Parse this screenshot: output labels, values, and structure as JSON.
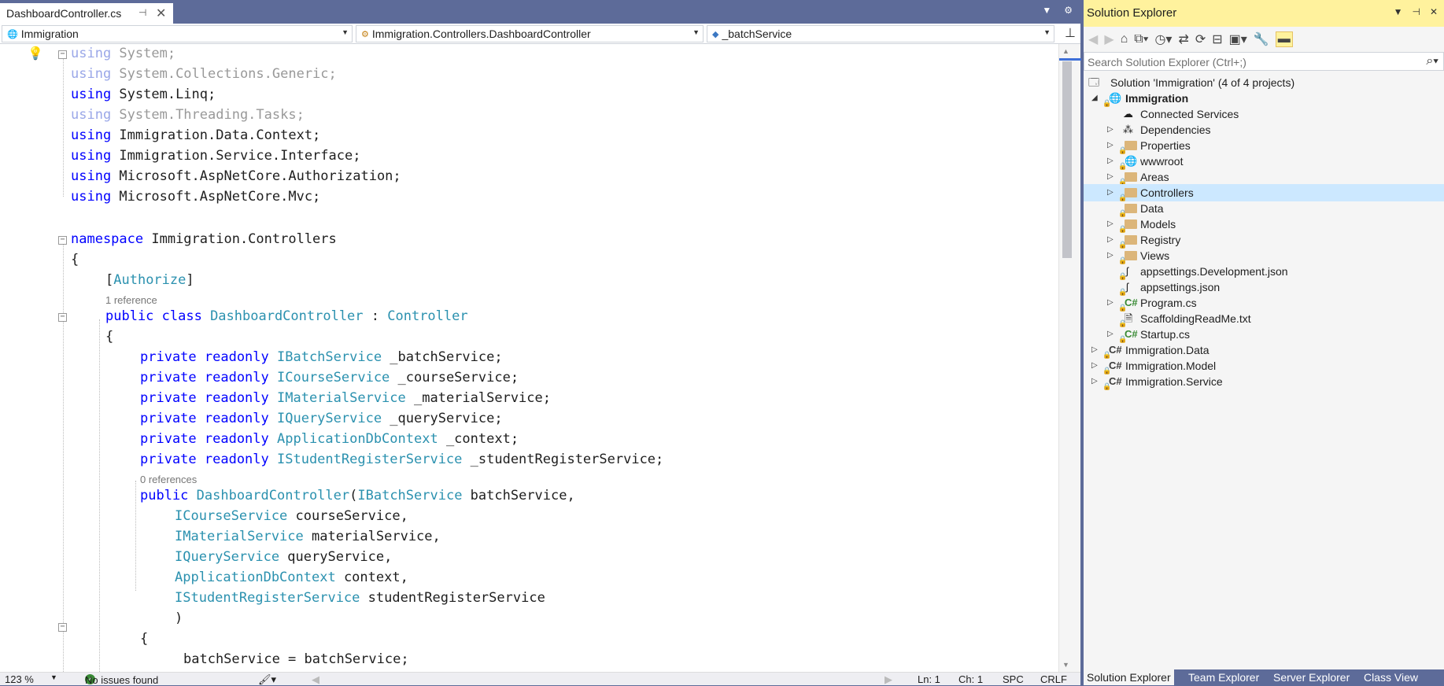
{
  "tab": {
    "title": "DashboardController.cs",
    "pin": "⊣",
    "close": "✕"
  },
  "navbar": {
    "project": "Immigration",
    "type": "Immigration.Controllers.DashboardController",
    "member": "_batchService"
  },
  "code": {
    "lines": [
      "using System;",
      "using System.Collections.Generic;",
      "using System.Linq;",
      "using System.Threading.Tasks;",
      "using Immigration.Data.Context;",
      "using Immigration.Service.Interface;",
      "using Microsoft.AspNetCore.Authorization;",
      "using Microsoft.AspNetCore.Mvc;",
      "namespace Immigration.Controllers",
      "{",
      "[Authorize]",
      "public class DashboardController : Controller",
      "{",
      "private readonly IBatchService _batchService;",
      "private readonly ICourseService _courseService;",
      "private readonly IMaterialService _materialService;",
      "private readonly IQueryService _queryService;",
      "private readonly ApplicationDbContext _context;",
      "private readonly IStudentRegisterService _studentRegisterService;",
      "public DashboardController(IBatchService batchService,",
      "ICourseService courseService,",
      "IMaterialService materialService,",
      "IQueryService queryService,",
      "ApplicationDbContext context,",
      "IStudentRegisterService studentRegisterService",
      ")",
      "{",
      "batchService = batchService;"
    ],
    "lens_class": "1 reference",
    "lens_ctor": "0 references"
  },
  "status": {
    "zoom": "123 %",
    "issues": "No issues found",
    "line": "Ln: 1",
    "col": "Ch: 1",
    "spc": "SPC",
    "eol": "CRLF"
  },
  "solution_explorer": {
    "title": "Solution Explorer",
    "search_placeholder": "Search Solution Explorer (Ctrl+;)",
    "solution": "Solution 'Immigration' (4 of 4 projects)",
    "project": "Immigration",
    "items": [
      "Connected Services",
      "Dependencies",
      "Properties",
      "wwwroot",
      "Areas",
      "Controllers",
      "Data",
      "Models",
      "Registry",
      "Views",
      "appsettings.Development.json",
      "appsettings.json",
      "Program.cs",
      "ScaffoldingReadMe.txt",
      "Startup.cs"
    ],
    "projects": [
      "Immigration.Data",
      "Immigration.Model",
      "Immigration.Service"
    ],
    "tabs": [
      "Solution Explorer",
      "Team Explorer",
      "Server Explorer",
      "Class View"
    ]
  }
}
